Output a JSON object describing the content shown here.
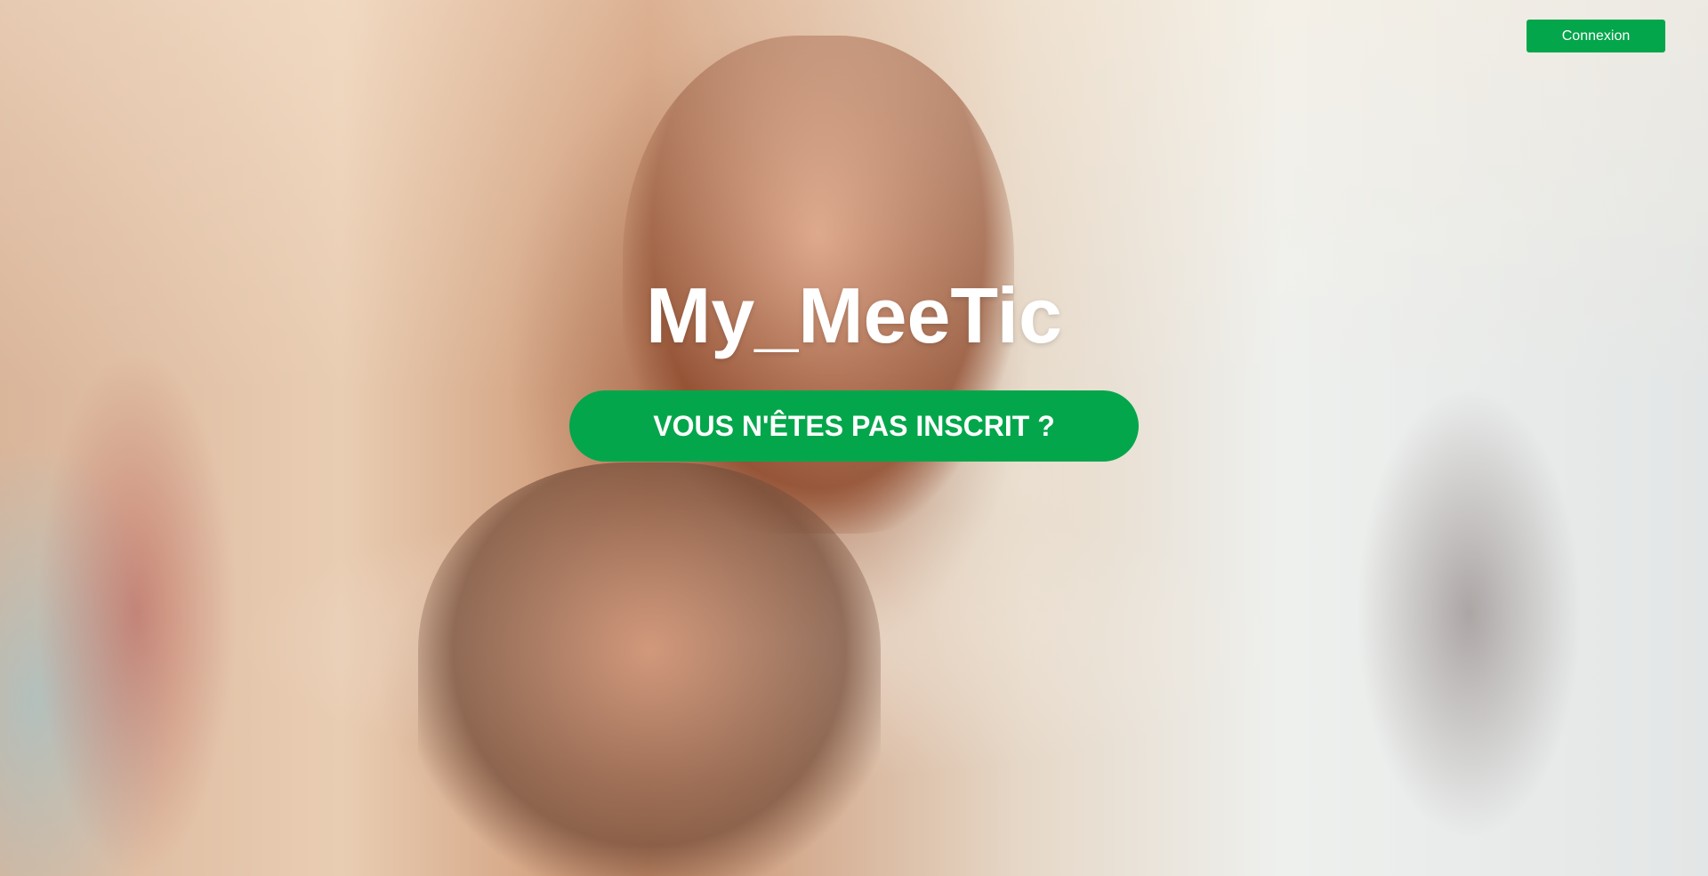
{
  "header": {
    "login_label": "Connexion"
  },
  "hero": {
    "title": "My_MeeTic",
    "cta_label": "VOUS N'ÊTES PAS INSCRIT ?"
  },
  "colors": {
    "accent": "#04a64b",
    "text_on_accent": "#ffffff"
  }
}
